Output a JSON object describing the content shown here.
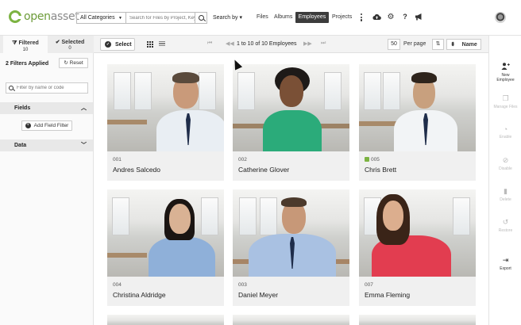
{
  "app": {
    "logo_left": "open",
    "logo_right": "asset"
  },
  "header": {
    "category_select": "All Categories",
    "search_placeholder": "Search for Files by Project, Key...",
    "search_by": "Search by",
    "nav": {
      "files": "Files",
      "albums": "Albums",
      "employees": "Employees",
      "projects": "Projects"
    },
    "icons": [
      "kebab-menu-icon",
      "cloud-upload-icon",
      "gear-icon",
      "help-icon",
      "announcement-icon",
      "avatar"
    ]
  },
  "left_panel": {
    "tabs": [
      {
        "label": "Filtered",
        "count": "10"
      },
      {
        "label": "Selected",
        "count": "0"
      }
    ],
    "filters_applied": "2 Filters Applied",
    "reset_label": "Reset",
    "filter_placeholder": "Filter by name or code",
    "fields_label": "Fields",
    "add_field_filter": "Add Field Filter",
    "data_label": "Data"
  },
  "toolbar": {
    "select_label": "Select",
    "pager_text": "1 to 10 of 10 Employees",
    "per_page_value": "50",
    "per_page_label": "Per page",
    "sort_label": "Name"
  },
  "right_panel": [
    {
      "label_line1": "New",
      "label_line2": "Employee",
      "icon": "add-person-icon",
      "enabled": true
    },
    {
      "label_line1": "Manage Files",
      "label_line2": "",
      "icon": "manage-files-icon",
      "enabled": false
    },
    {
      "label_line1": "Enable",
      "label_line2": "",
      "icon": "enable-icon",
      "enabled": false
    },
    {
      "label_line1": "Disable",
      "label_line2": "",
      "icon": "disable-icon",
      "enabled": false
    },
    {
      "label_line1": "Delete",
      "label_line2": "",
      "icon": "trash-icon",
      "enabled": false
    },
    {
      "label_line1": "Restore",
      "label_line2": "",
      "icon": "restore-icon",
      "enabled": false
    },
    {
      "label_line1": "Export",
      "label_line2": "",
      "icon": "export-icon",
      "enabled": true
    }
  ],
  "employees": [
    {
      "code": "001",
      "name": "Andres Salcedo"
    },
    {
      "code": "002",
      "name": "Catherine Glover"
    },
    {
      "code": "005",
      "name": "Chris Brett"
    },
    {
      "code": "004",
      "name": "Christina Aldridge"
    },
    {
      "code": "003",
      "name": "Daniel Meyer"
    },
    {
      "code": "007",
      "name": "Emma Fleming"
    }
  ],
  "colors": {
    "brand_green": "#7cb342",
    "active_nav": "#3c3c3c"
  }
}
